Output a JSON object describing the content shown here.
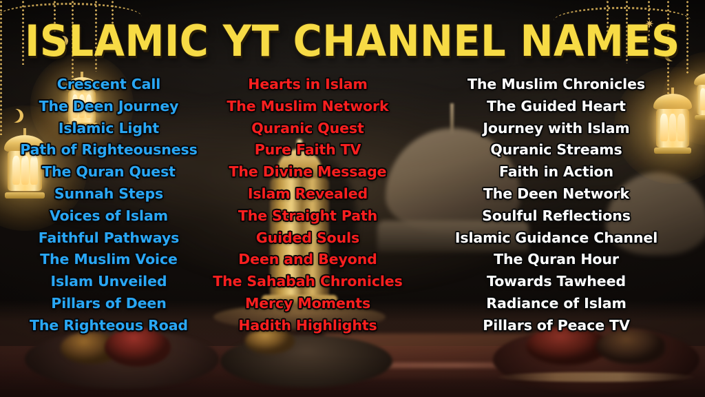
{
  "poster": {
    "title": "ISLAMIC YT CHANNEL NAMES",
    "title_color": "#F7DB45",
    "background_theme": "ramadan-iftar-table-with-mosque-dome"
  },
  "decor": {
    "lantern_color": "#FFD97F",
    "chain_color": "#D3AD58",
    "left": {
      "icons": [
        "hanging-lantern",
        "hanging-lantern",
        "crescent-moon",
        "crescent-moon",
        "star",
        "chain-swag"
      ]
    },
    "right": {
      "icons": [
        "hanging-lantern",
        "hanging-lantern",
        "crescent-moon",
        "star",
        "chain-swag"
      ]
    }
  },
  "columns": [
    {
      "id": "column-1",
      "color": "#29A7F5",
      "names": [
        "Crescent Call",
        "The Deen Journey",
        "Islamic Light",
        "Path of Righteousness",
        "The Quran Quest",
        "Sunnah Steps",
        "Voices of Islam",
        "Faithful Pathways",
        "The Muslim Voice",
        "Islam Unveiled",
        "Pillars of Deen",
        "The Righteous Road"
      ]
    },
    {
      "id": "column-2",
      "color": "#FA1F1F",
      "names": [
        "Hearts in Islam",
        "The Muslim Network",
        "Quranic Quest",
        "Pure Faith TV",
        "The Divine Message",
        "Islam Revealed",
        "The Straight Path",
        "Guided Souls",
        "Deen and Beyond",
        "The Sahabah Chronicles",
        "Mercy Moments",
        "Hadith Highlights"
      ]
    },
    {
      "id": "column-3",
      "color": "#FFFFFF",
      "names": [
        "The Muslim Chronicles",
        "The Guided Heart",
        "Journey with Islam",
        "Quranic Streams",
        "Faith in Action",
        "The Deen Network",
        "Soulful Reflections",
        "Islamic Guidance Channel",
        "The Quran Hour",
        "Towards Tawheed",
        "Radiance of Islam",
        "Pillars of Peace TV"
      ]
    }
  ]
}
